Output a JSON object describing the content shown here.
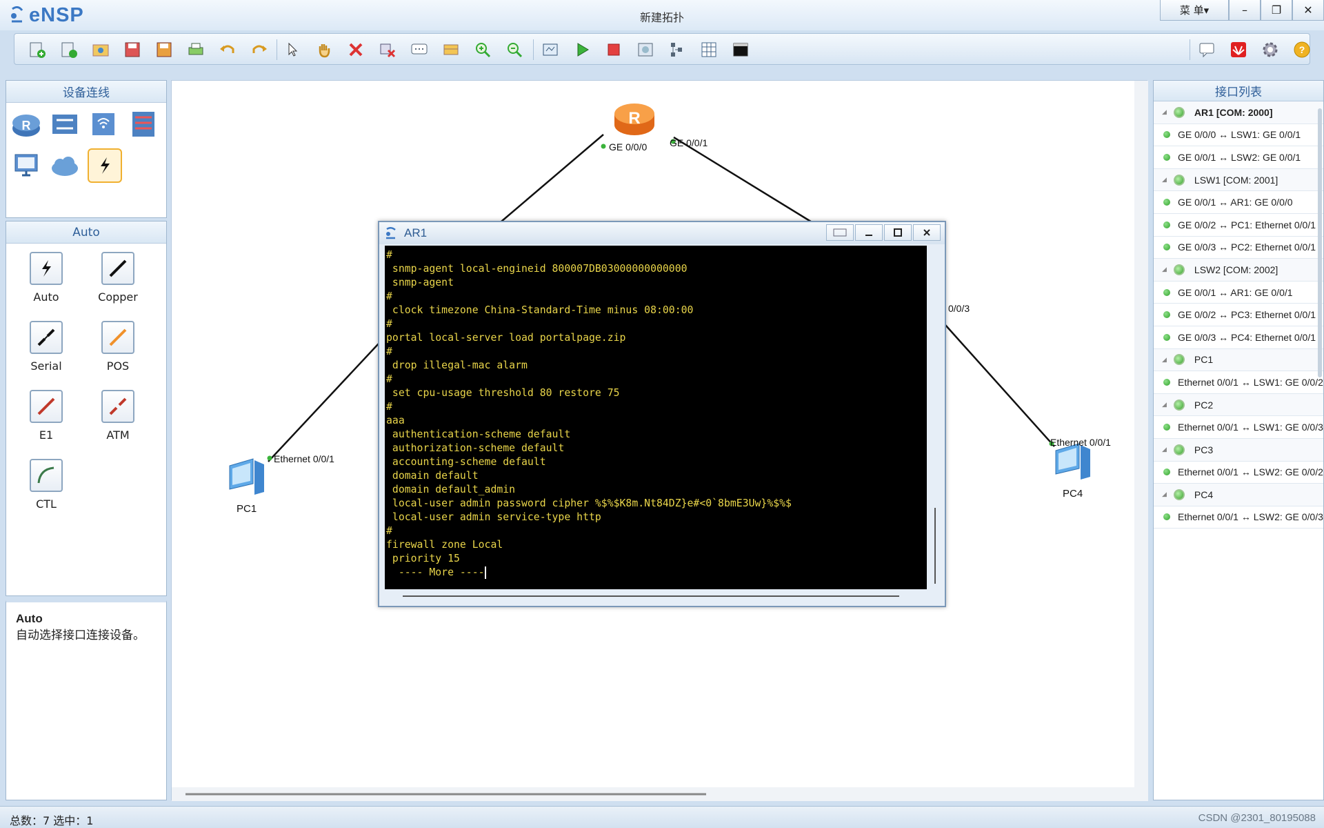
{
  "app": {
    "name": "eNSP",
    "title": "新建拓扑",
    "menu_label": "菜 单",
    "minimize": "–",
    "restore": "❐",
    "close": "✕"
  },
  "toolbar": {
    "left_icons": [
      "new-topology-icon",
      "new-tab-icon",
      "open-icon",
      "save-icon",
      "save-as-icon",
      "print-icon",
      "undo-icon",
      "redo-icon",
      "select-icon",
      "pan-hand-icon",
      "delete-icon",
      "delete-link-icon",
      "text-icon",
      "palette-icon",
      "zoom-in-icon",
      "zoom-out-icon",
      "fit-icon",
      "start-icon",
      "stop-icon",
      "capture-icon",
      "layout-icon",
      "grid-icon",
      "terminal-icon"
    ],
    "right_icons": [
      "chat-icon",
      "huawei-icon",
      "settings-icon",
      "help-icon"
    ]
  },
  "devices_panel": {
    "title": "设备连线"
  },
  "auto_panel": {
    "title": "Auto",
    "cables": [
      "Auto",
      "Copper",
      "Serial",
      "POS",
      "E1",
      "ATM",
      "CTL"
    ]
  },
  "desc_panel": {
    "title": "Auto",
    "text": "自动选择接口连接设备。"
  },
  "topology": {
    "labels": {
      "ar1_ge000": "GE 0/0/0",
      "ar1_ge001": "GE 0/0/1",
      "pc1_if": "Ethernet 0/0/1",
      "pc1_name": "PC1",
      "lsw_if": "0/0/3",
      "pc4_if": "Ethernet 0/0/1",
      "pc4_name": "PC4"
    }
  },
  "terminal": {
    "title": "AR1",
    "lines": [
      "#",
      " snmp-agent local-engineid 800007DB03000000000000",
      " snmp-agent",
      "#",
      " clock timezone China-Standard-Time minus 08:00:00",
      "#",
      "portal local-server load portalpage.zip",
      "#",
      " drop illegal-mac alarm",
      "#",
      " set cpu-usage threshold 80 restore 75",
      "#",
      "aaa",
      " authentication-scheme default",
      " authorization-scheme default",
      " accounting-scheme default",
      " domain default",
      " domain default_admin",
      " local-user admin password cipher %$%$K8m.Nt84DZ}e#<0`8bmE3Uw}%$%$",
      " local-user admin service-type http",
      "#",
      "firewall zone Local",
      " priority 15",
      "  ---- More ----"
    ]
  },
  "interface_list": {
    "title": "接口列表",
    "rows": [
      {
        "type": "device",
        "text": "AR1 [COM: 2000]",
        "bold": true
      },
      {
        "type": "link",
        "text": "GE 0/0/0 ↔ LSW1: GE 0/0/1"
      },
      {
        "type": "link",
        "text": "GE 0/0/1 ↔ LSW2: GE 0/0/1"
      },
      {
        "type": "device",
        "text": "LSW1 [COM: 2001]"
      },
      {
        "type": "link",
        "text": "GE 0/0/1 ↔ AR1: GE 0/0/0"
      },
      {
        "type": "link",
        "text": "GE 0/0/2 ↔ PC1: Ethernet 0/0/1"
      },
      {
        "type": "link",
        "text": "GE 0/0/3 ↔ PC2: Ethernet 0/0/1"
      },
      {
        "type": "device",
        "text": "LSW2 [COM: 2002]"
      },
      {
        "type": "link",
        "text": "GE 0/0/1 ↔ AR1: GE 0/0/1"
      },
      {
        "type": "link",
        "text": "GE 0/0/2 ↔ PC3: Ethernet 0/0/1"
      },
      {
        "type": "link",
        "text": "GE 0/0/3 ↔ PC4: Ethernet 0/0/1"
      },
      {
        "type": "device",
        "text": "PC1"
      },
      {
        "type": "link",
        "text": "Ethernet 0/0/1 ↔ LSW1: GE 0/0/2"
      },
      {
        "type": "device",
        "text": "PC2"
      },
      {
        "type": "link",
        "text": "Ethernet 0/0/1 ↔ LSW1: GE 0/0/3"
      },
      {
        "type": "device",
        "text": "PC3"
      },
      {
        "type": "link",
        "text": "Ethernet 0/0/1 ↔ LSW2: GE 0/0/2"
      },
      {
        "type": "device",
        "text": "PC4"
      },
      {
        "type": "link",
        "text": "Ethernet 0/0/1 ↔ LSW2: GE 0/0/3"
      }
    ]
  },
  "status": {
    "text": "总数：7  选中：1",
    "watermark": "CSDN @2301_80195088"
  }
}
